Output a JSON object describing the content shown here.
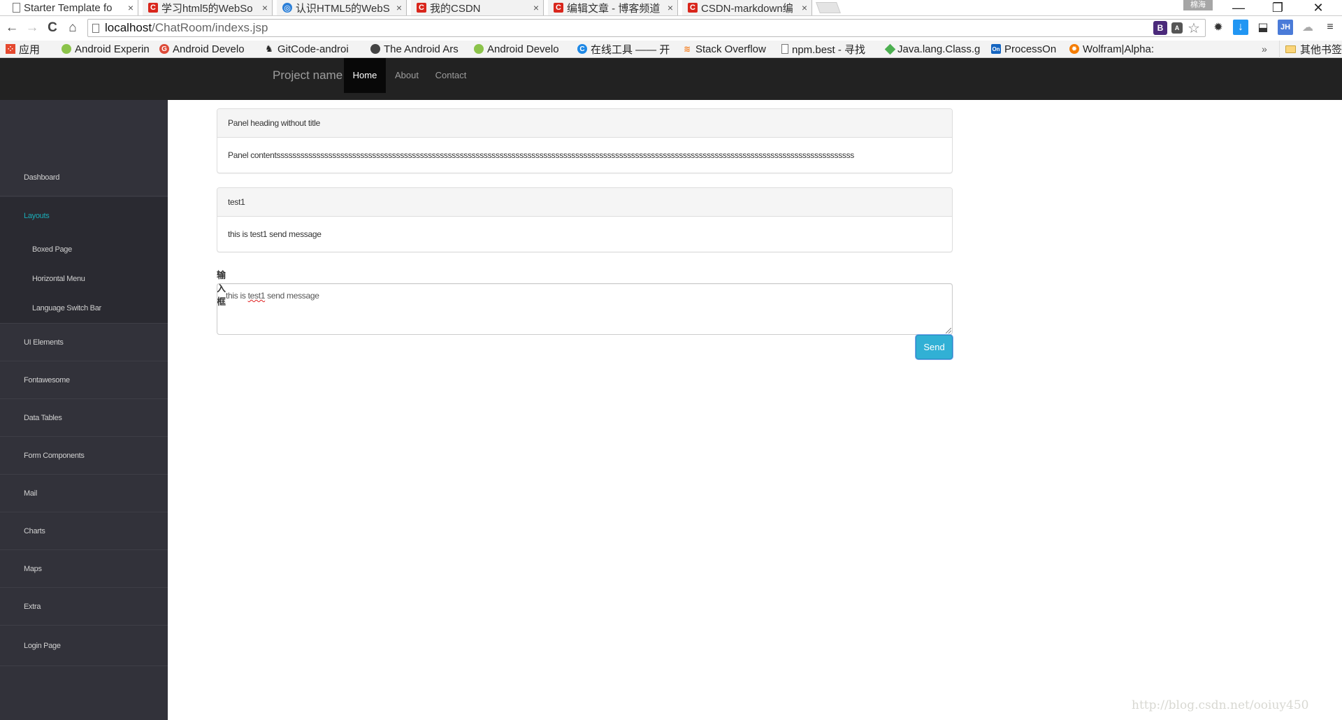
{
  "browser": {
    "tabs": [
      {
        "title": "Starter Template fo",
        "icon": "page-icon",
        "active": true
      },
      {
        "title": "学习html5的WebSo",
        "icon": "csdn-icon",
        "active": false
      },
      {
        "title": "认识HTML5的WebS",
        "icon": "websocket-icon",
        "active": false
      },
      {
        "title": "我的CSDN",
        "icon": "csdn-icon",
        "active": false
      },
      {
        "title": "编辑文章 - 博客频道",
        "icon": "csdn-icon",
        "active": false
      },
      {
        "title": "CSDN-markdown编",
        "icon": "csdn-icon",
        "active": false
      }
    ],
    "tab_close_glyph": "×",
    "user_badge": "棉海",
    "window_controls": {
      "minimize": "—",
      "restore": "❐",
      "close": "✕"
    },
    "nav": {
      "back": "←",
      "forward": "→",
      "reload": "C",
      "home": "⌂"
    },
    "url": {
      "host": "localhost",
      "path": "/ChatRoom/indexs.jsp"
    },
    "omnibox_extensions": [
      {
        "name": "bootstrap-extension-icon",
        "glyph": "B"
      },
      {
        "name": "translate-icon",
        "glyph": "A"
      },
      {
        "name": "bookmark-star-icon",
        "glyph": "☆"
      }
    ],
    "toolbar_icons": [
      {
        "name": "settings-gear-icon",
        "glyph": "✹"
      },
      {
        "name": "download-icon",
        "glyph": "↓"
      },
      {
        "name": "cast-icon",
        "glyph": "⬓"
      },
      {
        "name": "jh-extension-icon",
        "glyph": "JH"
      },
      {
        "name": "cloud-icon",
        "glyph": "☁"
      },
      {
        "name": "menu-icon",
        "glyph": "≡"
      }
    ],
    "bookmarks": [
      {
        "label": "应用",
        "icon": "apps-grid-icon",
        "color": "#e5492f"
      },
      {
        "label": "Android Experin",
        "icon": "android-icon",
        "color": "#8bc34a"
      },
      {
        "label": "Android Develo",
        "icon": "google-plus-icon",
        "color": "#dd4b39"
      },
      {
        "label": "GitCode-androi",
        "icon": "dog-icon",
        "color": "#222222"
      },
      {
        "label": "The Android Ars",
        "icon": "bomb-icon",
        "color": "#444444"
      },
      {
        "label": "Android Develo",
        "icon": "android-icon",
        "color": "#8bc34a"
      },
      {
        "label": "在线工具 —— 开",
        "icon": "c-tool-icon",
        "color": "#1e88e5"
      },
      {
        "label": "Stack Overflow",
        "icon": "stackoverflow-icon",
        "color": "#f48024"
      },
      {
        "label": "npm.best - 寻找",
        "icon": "page-icon",
        "color": "#ffffff"
      },
      {
        "label": "Java.lang.Class.g",
        "icon": "java-icon",
        "color": "#4caf50"
      },
      {
        "label": "ProcessOn",
        "icon": "processon-icon",
        "color": "#1565c0"
      },
      {
        "label": "Wolfram|Alpha:",
        "icon": "wolfram-icon",
        "color": "#f57c00"
      }
    ],
    "bookmarks_overflow": "»",
    "other_bookmarks": "其他书签"
  },
  "navbar": {
    "brand": "Project name",
    "links": [
      {
        "label": "Home",
        "active": true
      },
      {
        "label": "About",
        "active": false
      },
      {
        "label": "Contact",
        "active": false
      }
    ]
  },
  "sidebar": {
    "items": [
      {
        "label": "Dashboard"
      },
      {
        "label": "Layouts",
        "active": true,
        "children": [
          "Boxed Page",
          "Horizontal Menu",
          "Language Switch Bar"
        ]
      },
      {
        "label": "UI Elements"
      },
      {
        "label": "Fontawesome"
      },
      {
        "label": "Data Tables"
      },
      {
        "label": "Form Components"
      },
      {
        "label": "Mail"
      },
      {
        "label": "Charts"
      },
      {
        "label": "Maps"
      },
      {
        "label": "Extra"
      },
      {
        "label": "Login Page"
      }
    ],
    "active_color": "#1aacb7"
  },
  "panels": [
    {
      "heading": "Panel heading without title",
      "body": "Panel contentsssssssssssssssssssssssssssssssssssssssssssssssssssssssssssssssssssssssssssssssssssssssssssssssssssssssssssssssssssssssssssssssssssssssssssssssss"
    },
    {
      "heading": "test1",
      "body": "this is test1 send message"
    }
  ],
  "form": {
    "label": "输入框",
    "textarea_value_before": "this is ",
    "textarea_value_misspelled": "test1",
    "textarea_value_after": " send message",
    "send_label": "Send",
    "send_color": "#31b0d5"
  },
  "watermark": "http://blog.csdn.net/ooiuy450"
}
